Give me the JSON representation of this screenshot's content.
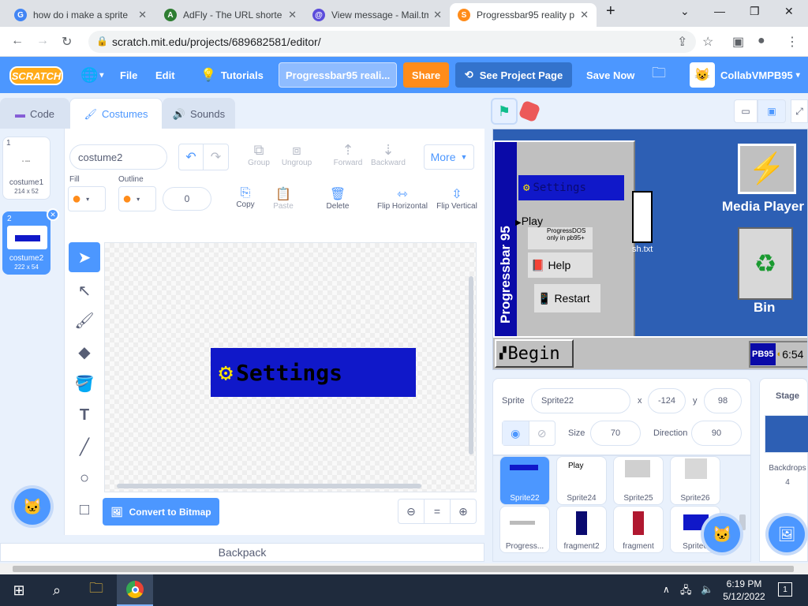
{
  "browser": {
    "tabs": [
      {
        "title": "how do i make a sprite",
        "icon": "google-icon",
        "color": "#4285f4"
      },
      {
        "title": "AdFly - The URL shorte",
        "icon": "adfly-icon",
        "color": "#2e7d32"
      },
      {
        "title": "View message - Mail.tm",
        "icon": "mail-icon",
        "color": "#5b4cdb"
      },
      {
        "title": "Progressbar95 reality p",
        "icon": "scratch-icon",
        "color": "#ff8c1a"
      }
    ],
    "url": "scratch.mit.edu/projects/689682581/editor/"
  },
  "menubar": {
    "logo": "SCRATCH",
    "file": "File",
    "edit": "Edit",
    "tutorials": "Tutorials",
    "project_title": "Progressbar95 reali...",
    "share": "Share",
    "see_project": "See Project Page",
    "save_now": "Save Now",
    "username": "CollabVMPB95"
  },
  "editor_tabs": {
    "code": "Code",
    "costumes": "Costumes",
    "sounds": "Sounds"
  },
  "costumes": [
    {
      "index": "1",
      "name": "costume1",
      "size": "214 x 52"
    },
    {
      "index": "2",
      "name": "costume2",
      "size": "222 x 54"
    }
  ],
  "paint": {
    "costume_name": "costume2",
    "group": "Group",
    "ungroup": "Ungroup",
    "forward": "Forward",
    "backward": "Backward",
    "more": "More",
    "fill_label": "Fill",
    "outline_label": "Outline",
    "outline_width": "0",
    "copy": "Copy",
    "paste": "Paste",
    "delete": "Delete",
    "flip_h": "Flip Horizontal",
    "flip_v": "Flip Vertical",
    "convert": "Convert to Bitmap",
    "canvas_text": "Settings",
    "costume_color": "#1018c9"
  },
  "backpack": "Backpack",
  "stage_content": {
    "menu_settings": "Settings",
    "menu_play": "Play",
    "menu_progressdos": "ProgressDOS",
    "menu_progressdos_note": "only in pb95+",
    "menu_help": "Help",
    "menu_restart": "Restart",
    "sidebar": "Progressbar 95",
    "begin": "Begin",
    "pb95_badge": "PB95",
    "clock": "6:54",
    "media_player": "Media Player",
    "bin": "Bin",
    "file_label": "sh.txt"
  },
  "sprite_info": {
    "sprite_label": "Sprite",
    "sprite_name": "Sprite22",
    "x_label": "x",
    "x": "-124",
    "y_label": "y",
    "y": "98",
    "size_label": "Size",
    "size": "70",
    "direction_label": "Direction",
    "direction": "90"
  },
  "sprites": [
    "Sprite22",
    "Sprite24",
    "Sprite25",
    "Sprite26",
    "Progress...",
    "fragment2",
    "fragment",
    "Sprite6"
  ],
  "sprite_thumb_text": "Play",
  "stage_panel": {
    "label": "Stage",
    "backdrops_label": "Backdrops",
    "backdrops_count": "4"
  },
  "taskbar": {
    "time": "6:19 PM",
    "date": "5/12/2022",
    "notifications": "1"
  }
}
